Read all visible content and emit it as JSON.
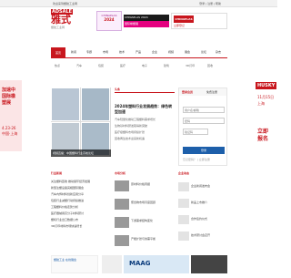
{
  "topbar": {
    "left_text": "欢迎来到塑胶工业网",
    "right_text": "登录 | 注册 | 帮助"
  },
  "logo": {
    "badge": "ADSALE",
    "main": "雅式",
    "sub": "塑胶工业网"
  },
  "promos": {
    "p1_label": "CHINAPLAS",
    "p1_big": "2024",
    "p2_line1": "CHINAPLAS 2024",
    "p2_line2": "国际橡塑展",
    "p3_logo": "CHINAPLAS",
    "p3_text": "立即登记"
  },
  "nav": {
    "home": "首页",
    "items": [
      "新闻",
      "专题",
      "市场",
      "技术",
      "产品",
      "企业",
      "视频",
      "展会",
      "论坛",
      "杂志"
    ]
  },
  "subnav": {
    "items": [
      "热点",
      "汽车",
      "包装",
      "医疗",
      "电子",
      "建筑",
      "3D打印",
      "回收"
    ]
  },
  "side_left": {
    "line1": "加速中",
    "line2": "国际橡",
    "line3": "塑展",
    "date": "4.23-26",
    "city": "中国·上海"
  },
  "side_right": {
    "brand": "HUSKY",
    "line1": "11月15日",
    "line2": "上海",
    "line3": "立即",
    "line4": "报名"
  },
  "video": {
    "caption": "视频直播：中国塑料行业高峰论坛"
  },
  "news": {
    "section": "头条",
    "headline": "2024年塑料行业发展趋势：绿色转型加速",
    "lines": [
      "汽车轻量化推动工程塑料需求增长",
      "生物基材料研发取得新突破",
      "医疗级塑料市场持续扩张",
      "回收再生技术迎来新机遇"
    ]
  },
  "login": {
    "tab_login": "登录会员",
    "tab_register": "免费注册",
    "username_placeholder": "用户名/邮箱",
    "password_placeholder": "密码",
    "captcha_placeholder": "验证码",
    "submit": "登录",
    "meta": "忘记密码？ | 立即注册"
  },
  "sections": {
    "left": "行业新闻",
    "mid": "市场分析",
    "right": "企业动态"
  },
  "left_list": [
    "关注塑料回收 推动循环经济发展",
    "新型注塑设备亮相国际展会",
    "汽车内饰材料创新应用分享",
    "包装行业减塑行动持续推进",
    "工程塑料价格走势分析",
    "医疗器械用高分子材料研讨",
    "塑机行业出口数据公布",
    "3D打印材料市场快速增长"
  ],
  "mid_list": [
    "原材料价格周报",
    "聚合物市场月度回顾",
    "下游需求结构变化",
    "产能扩张与供需平衡"
  ],
  "right_list": [
    "企业新闻发布会",
    "新品上市推介",
    "合作签约仪式",
    "技术研讨会召开"
  ],
  "bottom": {
    "b1_text": "塑胶工业 在线展会",
    "b3_brand": "MAAG"
  }
}
